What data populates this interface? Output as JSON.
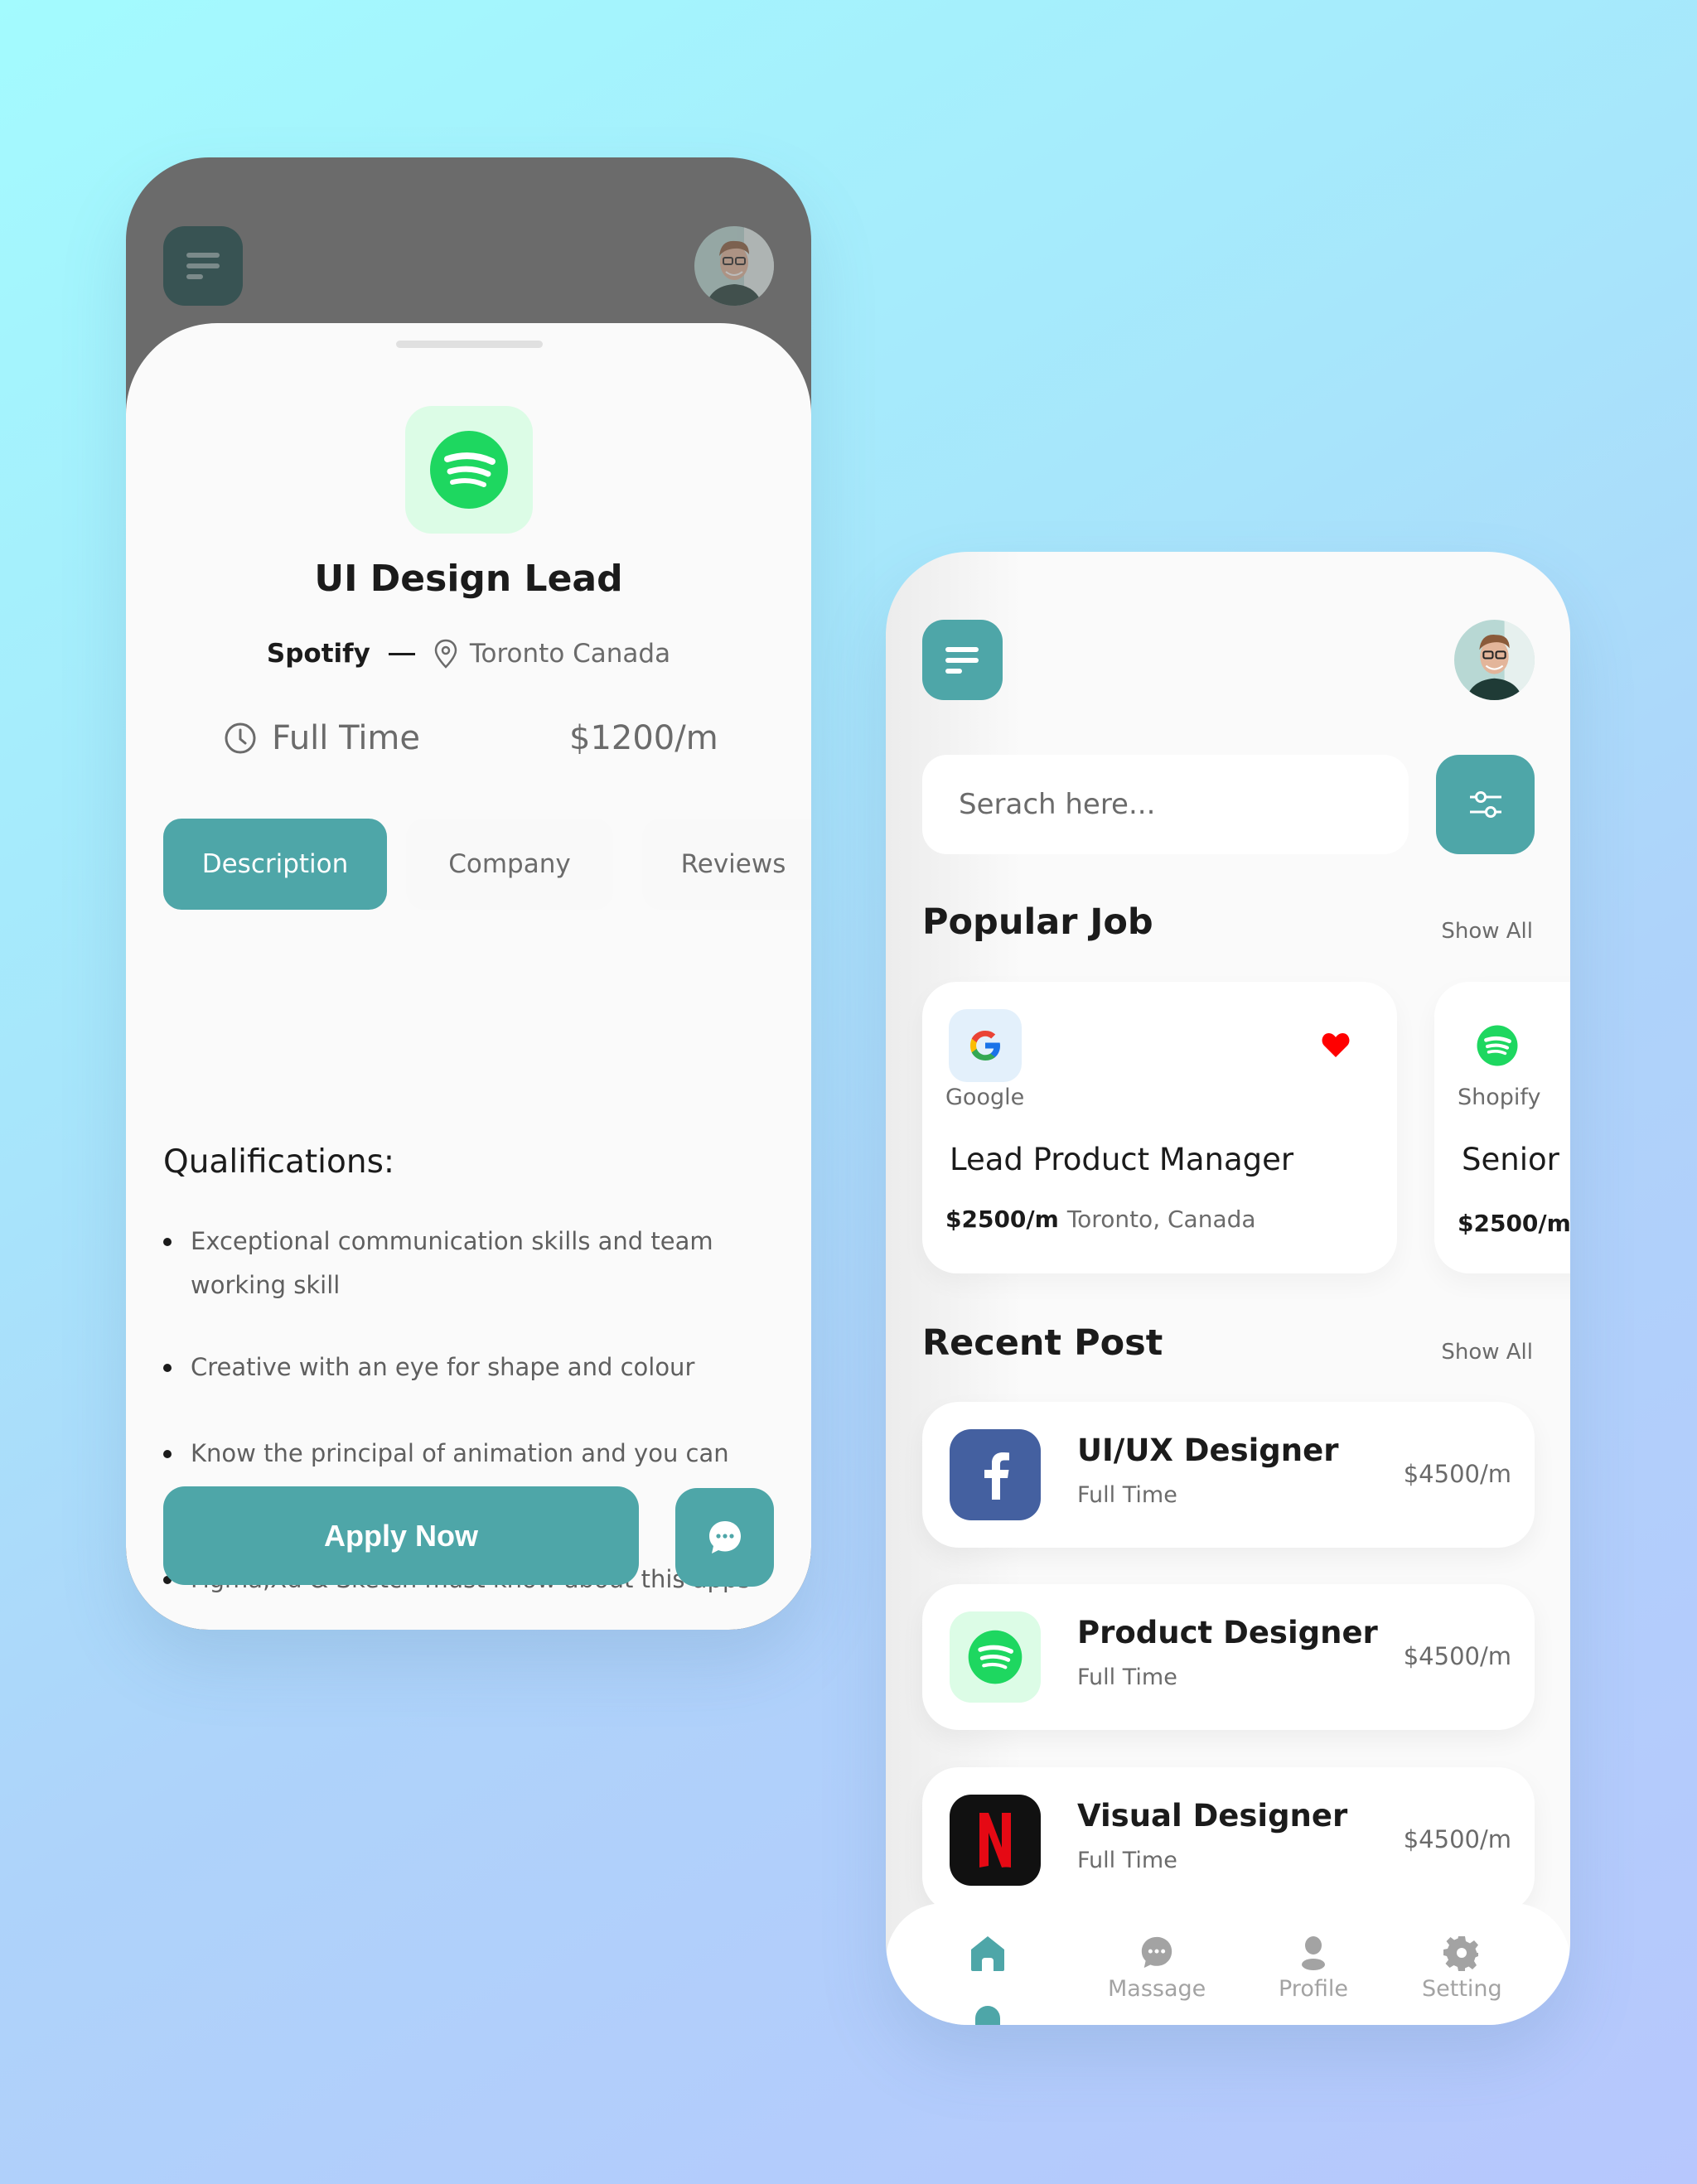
{
  "colors": {
    "accent": "#4ea6a8",
    "text_primary": "#1b1b1b",
    "text_secondary": "#6b6b6b",
    "spotify_green": "#1ed760",
    "facebook_blue": "#4460a0",
    "netflix_red": "#e50914",
    "heart_red": "#ff0000"
  },
  "job_detail": {
    "menu_icon": "menu-icon",
    "avatar": "user-avatar",
    "company_logo": "spotify-logo",
    "title": "UI Design Lead",
    "company": "Spotify",
    "location": "Toronto Canada",
    "job_type": "Full Time",
    "salary": "$1200/m",
    "tabs": [
      {
        "label": "Description",
        "active": true
      },
      {
        "label": "Company",
        "active": false
      },
      {
        "label": "Reviews",
        "active": false
      }
    ],
    "qualifications_heading": "Qualifications:",
    "qualifications": [
      "Exceptional communication skills and team working skill",
      "Creative with an eye for shape and colour",
      "Know the principal of animation and you can create high prtotypes",
      "Figma,Xd & Sketch must know about this apps"
    ],
    "apply_label": "Apply Now",
    "chat_icon": "chat-icon"
  },
  "home": {
    "search_placeholder": "Serach here...",
    "popular": {
      "title": "Popular Job",
      "show_all": "Show All",
      "cards": [
        {
          "company": "Google",
          "title": "Lead Product Manager",
          "salary": "$2500/m",
          "location": "Toronto, Canada",
          "favorited": true
        },
        {
          "company": "Shopify",
          "title": "Senior UI Designer",
          "salary": "$2500/m",
          "location": "",
          "favorited": false
        }
      ]
    },
    "recent": {
      "title": "Recent Post",
      "show_all": "Show All",
      "posts": [
        {
          "title": "UI/UX Designer",
          "type": "Full Time",
          "salary": "$4500/m",
          "logo": "facebook-logo"
        },
        {
          "title": "Product Designer",
          "type": "Full Time",
          "salary": "$4500/m",
          "logo": "spotify-logo"
        },
        {
          "title": "Visual Designer",
          "type": "Full Time",
          "salary": "$4500/m",
          "logo": "netflix-logo"
        }
      ]
    },
    "nav": [
      {
        "label": "",
        "icon": "home-icon",
        "active": true
      },
      {
        "label": "Massage",
        "icon": "message-icon",
        "active": false
      },
      {
        "label": "Profile",
        "icon": "profile-icon",
        "active": false
      },
      {
        "label": "Setting",
        "icon": "settings-icon",
        "active": false
      }
    ]
  }
}
